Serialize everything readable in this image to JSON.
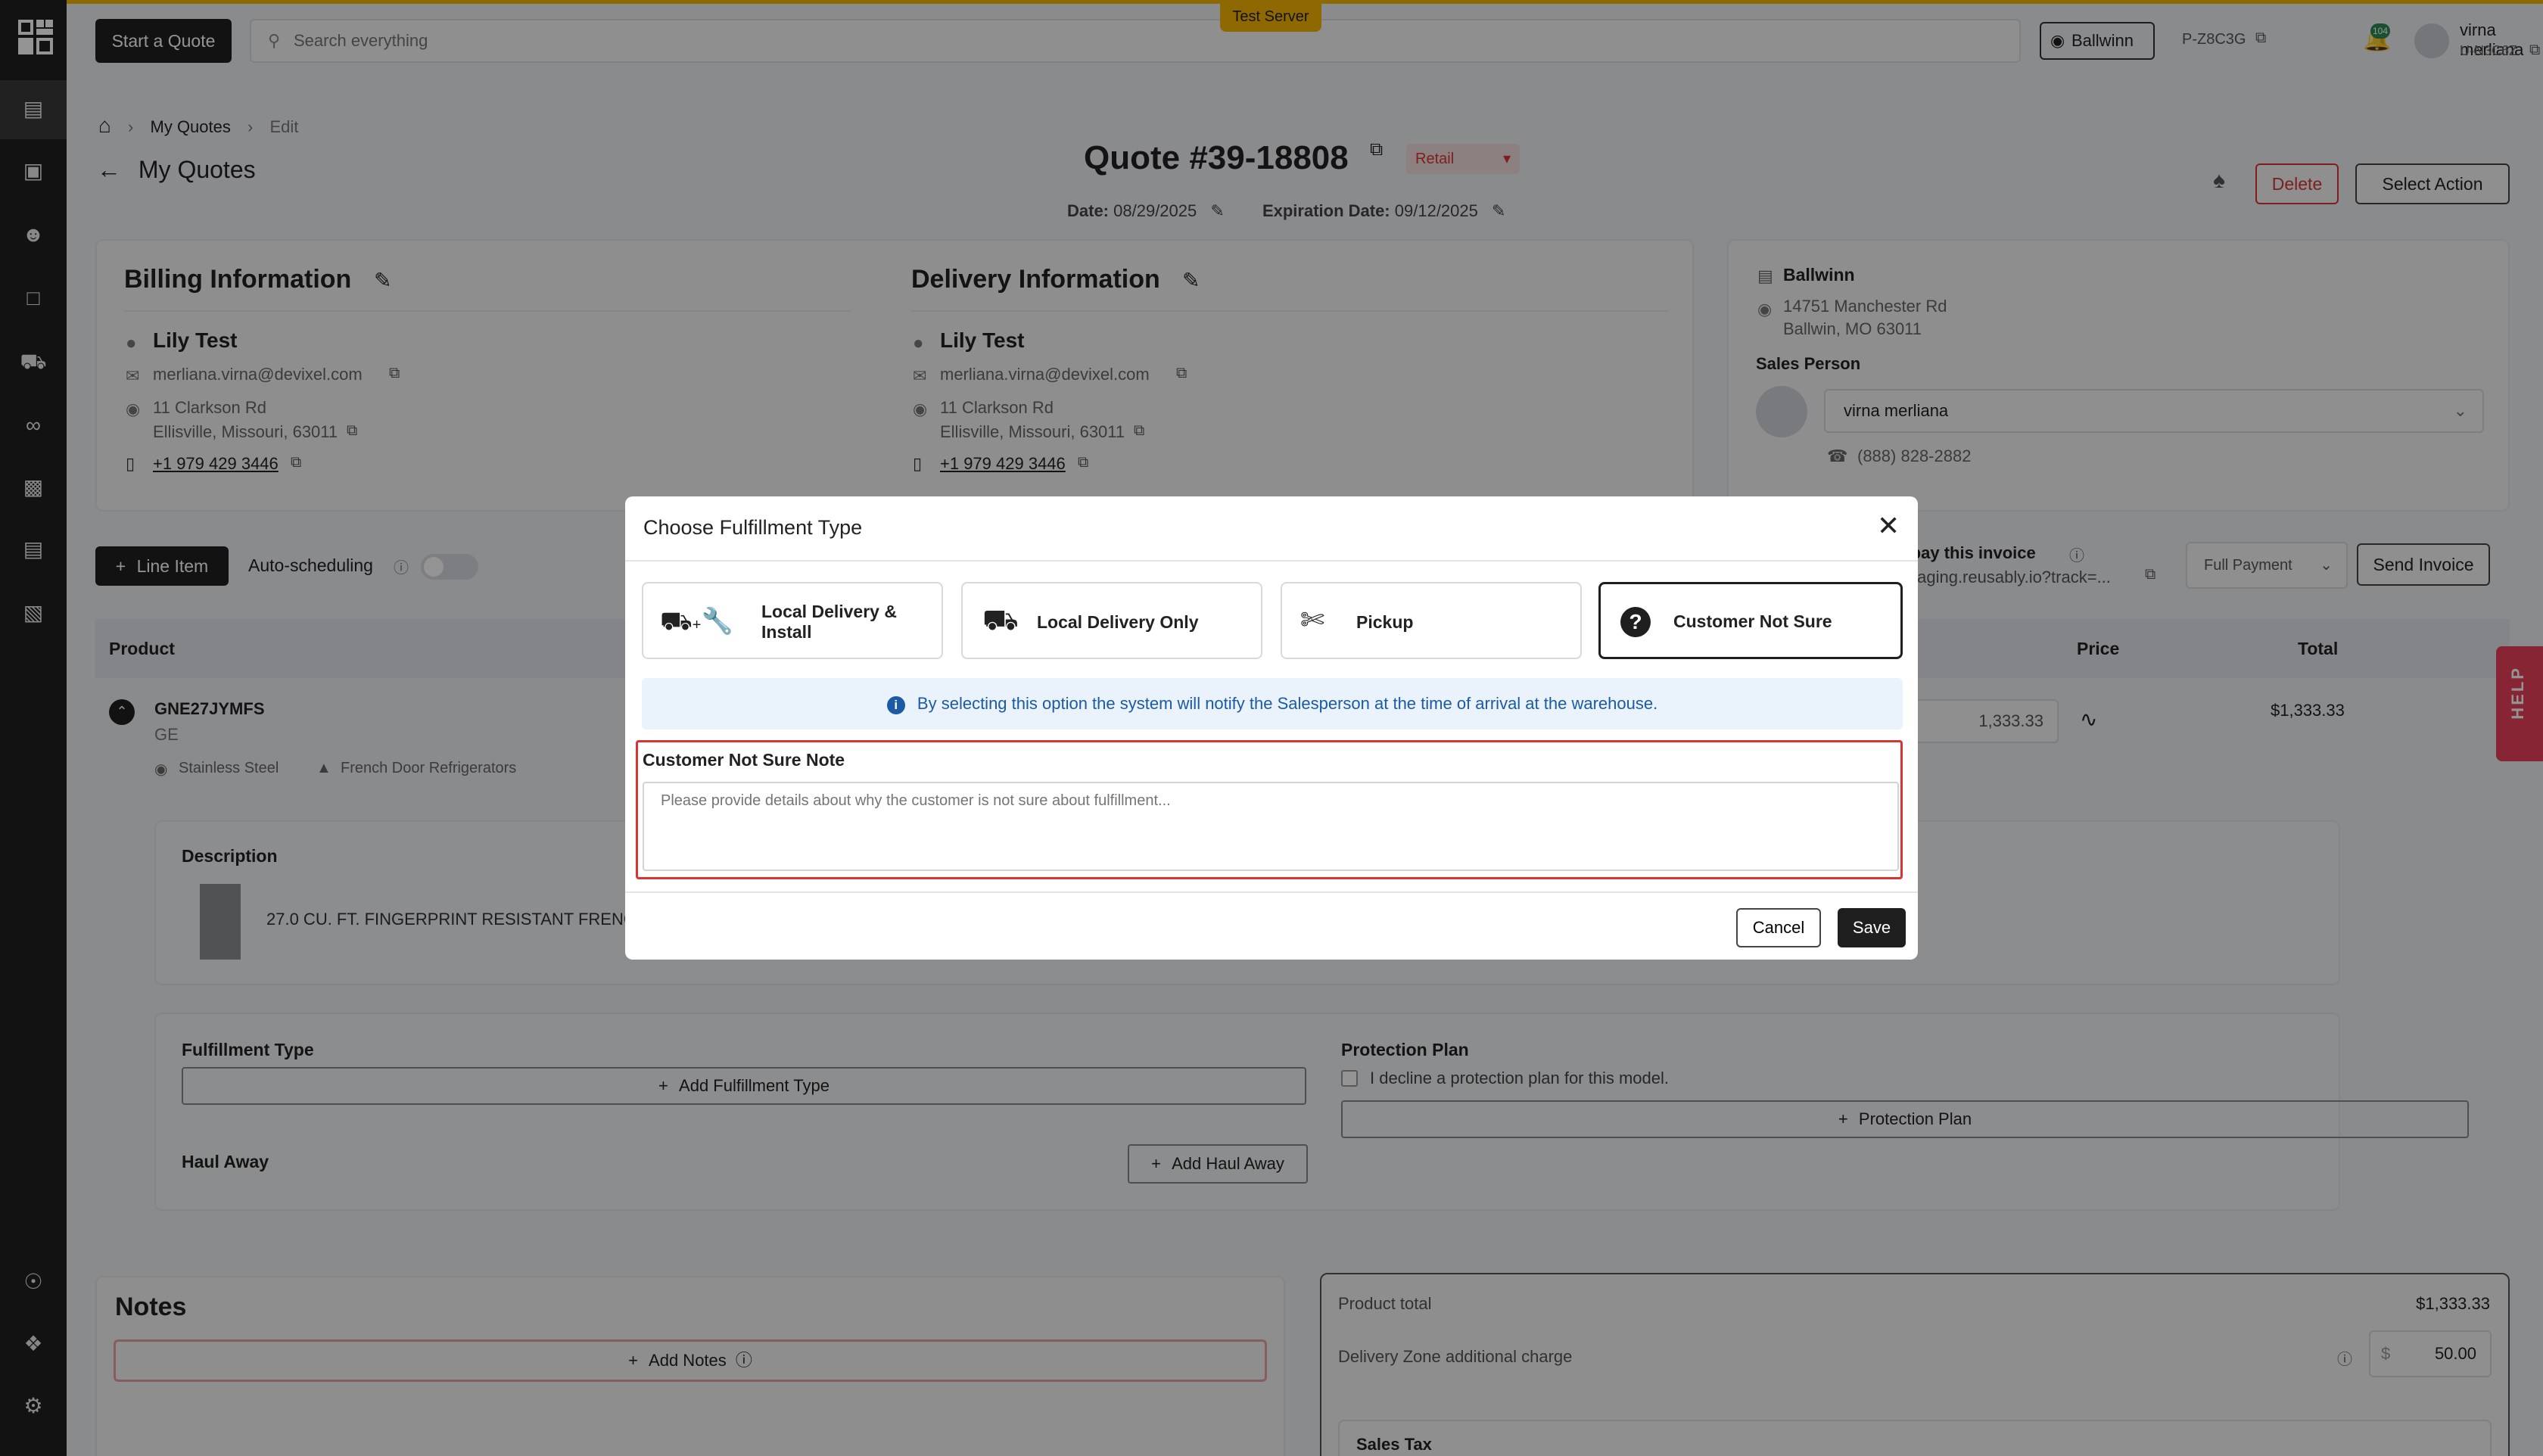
{
  "header": {
    "start_quote": "Start a Quote",
    "search_placeholder": "Search everything",
    "test_server": "Test Server",
    "location": "Ballwinn",
    "store_code": "P-Z8C3G",
    "notification_count": "104",
    "user_name": "virna merliana",
    "user_code": "U-N3C6Z"
  },
  "breadcrumb": {
    "section": "My Quotes",
    "current": "Edit"
  },
  "page": {
    "back_label": "My Quotes",
    "quote_title": "Quote #39-18808",
    "quote_type": "Retail",
    "date_label": "Date:",
    "date_value": "08/29/2025",
    "expiration_label": "Expiration Date:",
    "expiration_value": "09/12/2025",
    "delete": "Delete",
    "select_action": "Select Action"
  },
  "billing": {
    "heading": "Billing Information",
    "name": "Lily Test",
    "email": "merliana.virna@devixel.com",
    "address1": "11 Clarkson Rd",
    "address2": "Ellisville, Missouri, 63011",
    "phone": "+1 979 429 3446"
  },
  "delivery": {
    "heading": "Delivery Information",
    "name": "Lily Test",
    "email": "merliana.virna@devixel.com",
    "address1": "11 Clarkson Rd",
    "address2": "Ellisville, Missouri, 63011",
    "phone": "+1 979 429 3446"
  },
  "store": {
    "name": "Ballwinn",
    "address1": "14751 Manchester Rd",
    "address2": "Ballwin, MO 63011",
    "sales_person_label": "Sales Person",
    "sales_person": "virna merliana",
    "phone": "(888) 828-2882"
  },
  "toolbar": {
    "line_item": "Line Item",
    "auto_scheduling": "Auto-scheduling",
    "pay_invoice_partial": "r pay this invoice",
    "pay_link_partial": "staging.reusably.io?track=...",
    "payment_option": "Full Payment",
    "send_invoice": "Send Invoice"
  },
  "table": {
    "col_product": "Product",
    "col_price": "Price",
    "col_total": "Total",
    "sku": "GNE27JYMFS",
    "brand": "GE",
    "color": "Stainless Steel",
    "category": "French Door Refrigerators",
    "price": "1,333.33",
    "total": "$1,333.33",
    "description_label": "Description",
    "description": "27.0 CU. FT. FINGERPRINT RESISTANT FRENC"
  },
  "fulfillment": {
    "label": "Fulfillment Type",
    "add": "Add Fulfillment Type",
    "haul_away_label": "Haul Away",
    "add_haul_away": "Add Haul Away",
    "protection_label": "Protection Plan",
    "decline_text": "I decline a protection plan for this model.",
    "protection_button": "Protection Plan"
  },
  "notes": {
    "heading": "Notes",
    "add": "Add Notes"
  },
  "summary": {
    "product_total_label": "Product total",
    "product_total": "$1,333.33",
    "zone_label": "Delivery Zone additional charge",
    "currency": "$",
    "zone_value": "50.00",
    "sales_tax": "Sales Tax"
  },
  "help": "HELP",
  "modal": {
    "title": "Choose Fulfillment Type",
    "options": [
      {
        "label": "Local Delivery & Install",
        "icon": "truck-wrench-icon"
      },
      {
        "label": "Local Delivery Only",
        "icon": "truck-icon"
      },
      {
        "label": "Pickup",
        "icon": "hand-truck-icon"
      },
      {
        "label": "Customer Not Sure",
        "icon": "question-circle-icon",
        "selected": true
      }
    ],
    "info": "By selecting this option the system will notify the Salesperson at the time of arrival at the warehouse.",
    "note_label": "Customer Not Sure Note",
    "note_placeholder": "Please provide details about why the customer is not sure about fulfillment...",
    "cancel": "Cancel",
    "save": "Save"
  },
  "colors": {
    "accent": "#f5b400",
    "danger": "#d93434",
    "dark": "#1f1f1f",
    "info_bg": "#eaf2fb",
    "info_text": "#1c5aa6",
    "help": "#e8415a"
  }
}
